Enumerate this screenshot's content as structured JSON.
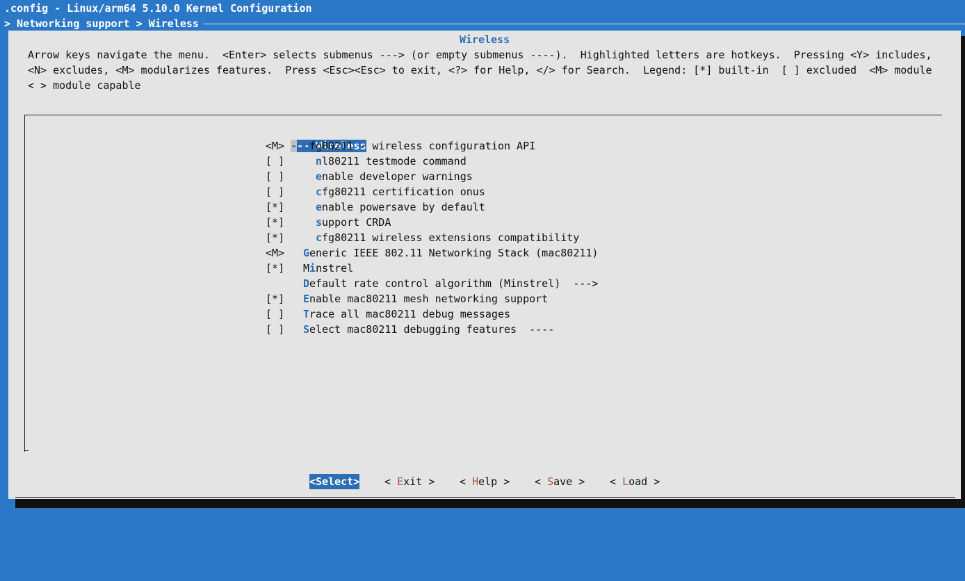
{
  "window": {
    "title": ".config - Linux/arm64 5.10.0 Kernel Configuration",
    "breadcrumb": "> Networking support > Wireless"
  },
  "dialog": {
    "title": "Wireless",
    "help_lines": [
      "Arrow keys navigate the menu.  <Enter> selects submenus ---> (or empty submenus ----).  Highlighted letters are hotkeys.  Pressing <Y> includes,",
      "<N> excludes, <M> modularizes features.  Press <Esc><Esc> to exit, <?> for Help, </> for Search.  Legend: [*] built-in  [ ] excluded  <M> module",
      "< > module capable"
    ]
  },
  "menu": {
    "header": {
      "mark": "---",
      "title": "Wireless"
    },
    "items": [
      {
        "mark": "<M>",
        "indent": 0,
        "hotkey": "c",
        "rest": "fg80211 - wireless configuration API"
      },
      {
        "mark": "[ ]",
        "indent": 1,
        "hotkey": "n",
        "rest": "l80211 testmode command"
      },
      {
        "mark": "[ ]",
        "indent": 1,
        "hotkey": "e",
        "rest": "nable developer warnings"
      },
      {
        "mark": "[ ]",
        "indent": 1,
        "hotkey": "c",
        "rest": "fg80211 certification onus"
      },
      {
        "mark": "[*]",
        "indent": 1,
        "hotkey": "e",
        "rest": "nable powersave by default"
      },
      {
        "mark": "[*]",
        "indent": 1,
        "hotkey": "s",
        "rest": "upport CRDA"
      },
      {
        "mark": "[*]",
        "indent": 1,
        "hotkey": "c",
        "rest": "fg80211 wireless extensions compatibility"
      },
      {
        "mark": "<M>",
        "indent": 0,
        "hotkey": "G",
        "rest": "eneric IEEE 802.11 Networking Stack (mac80211)"
      },
      {
        "mark": "[*]",
        "indent": 0,
        "pre": "M",
        "hotkey": "i",
        "rest": "nstrel"
      },
      {
        "mark": "",
        "indent": 0,
        "hotkey": "D",
        "rest": "efault rate control algorithm (Minstrel)  --->"
      },
      {
        "mark": "[*]",
        "indent": 0,
        "hotkey": "E",
        "rest": "nable mac80211 mesh networking support"
      },
      {
        "mark": "[ ]",
        "indent": 0,
        "hotkey": "T",
        "rest": "race all mac80211 debug messages"
      },
      {
        "mark": "[ ]",
        "indent": 0,
        "hotkey": "S",
        "rest": "elect mac80211 debugging features  ----"
      }
    ]
  },
  "buttons": [
    {
      "id": "select",
      "label": "<Select>",
      "active": true
    },
    {
      "id": "exit",
      "open": "< ",
      "hotkey": "E",
      "rest": "xit",
      "close": " >"
    },
    {
      "id": "help",
      "open": "< ",
      "hotkey": "H",
      "rest": "elp",
      "close": " >"
    },
    {
      "id": "save",
      "open": "< ",
      "hotkey": "S",
      "rest": "ave",
      "close": " >"
    },
    {
      "id": "load",
      "open": "< ",
      "hotkey": "L",
      "rest": "oad",
      "close": " >"
    }
  ],
  "colors": {
    "background": "#2c78c8",
    "dialog": "#e4e4e4",
    "accent": "#2c6db3",
    "button_hotkey": "#b0533b"
  }
}
